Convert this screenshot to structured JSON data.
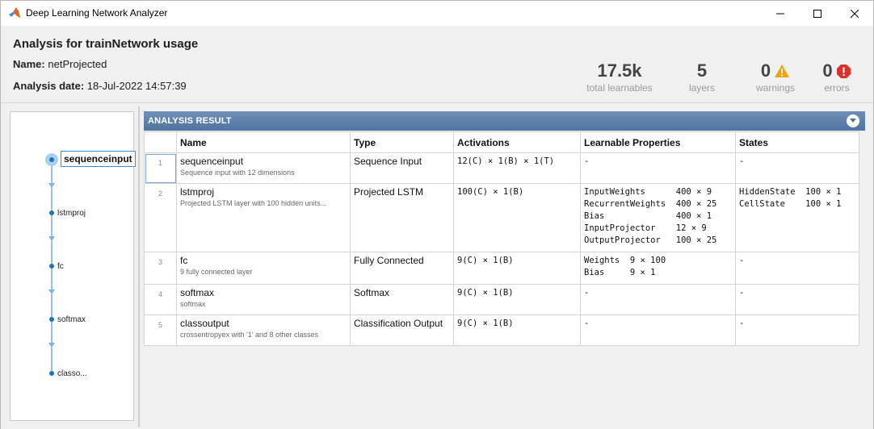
{
  "window": {
    "title": "Deep Learning Network Analyzer",
    "controls": {
      "minimize": "—",
      "maximize": "☐",
      "close": "✕"
    }
  },
  "header": {
    "title": "Analysis for trainNetwork usage",
    "name_label": "Name:",
    "name_value": "netProjected",
    "date_label": "Analysis date:",
    "date_value": "18-Jul-2022 14:57:39",
    "stats": {
      "learnables": {
        "value": "17.5k",
        "caption": "total learnables"
      },
      "layers": {
        "value": "5",
        "caption": "layers"
      },
      "warnings": {
        "value": "0",
        "caption": "warnings",
        "icon": "warning-icon",
        "color": "#f0a30a"
      },
      "errors": {
        "value": "0",
        "caption": "errors",
        "icon": "error-icon",
        "color": "#d9322b"
      }
    }
  },
  "graph": {
    "nodes": [
      {
        "label": "sequenceinput",
        "selected": true
      },
      {
        "label": "lstmproj"
      },
      {
        "label": "fc"
      },
      {
        "label": "softmax"
      },
      {
        "label": "classo..."
      }
    ],
    "accent": "#2f86c8"
  },
  "result": {
    "title": "ANALYSIS RESULT",
    "columns": [
      "",
      "Name",
      "Type",
      "Activations",
      "Learnable Properties",
      "States"
    ],
    "rows": [
      {
        "index": "1",
        "name": "sequenceinput",
        "desc": "Sequence input with 12 dimensions",
        "type": "Sequence Input",
        "activations": "12(C) × 1(B) × 1(T)",
        "learnables": "-",
        "states": "-"
      },
      {
        "index": "2",
        "name": "lstmproj",
        "desc": "Projected LSTM layer with 100 hidden units...",
        "type": "Projected LSTM",
        "activations": "100(C) × 1(B)",
        "learnables": "InputWeights      400 × 9\nRecurrentWeights  400 × 25\nBias              400 × 1\nInputProjector    12 × 9\nOutputProjector   100 × 25",
        "states": "HiddenState  100 × 1\nCellState    100 × 1"
      },
      {
        "index": "3",
        "name": "fc",
        "desc": "9 fully connected layer",
        "type": "Fully Connected",
        "activations": "9(C) × 1(B)",
        "learnables": "Weights  9 × 100\nBias     9 × 1",
        "states": "-"
      },
      {
        "index": "4",
        "name": "softmax",
        "desc": "softmax",
        "type": "Softmax",
        "activations": "9(C) × 1(B)",
        "learnables": "-",
        "states": "-"
      },
      {
        "index": "5",
        "name": "classoutput",
        "desc": "crossentropyex with '1' and 8 other classes",
        "type": "Classification Output",
        "activations": "9(C) × 1(B)",
        "learnables": "-",
        "states": "-"
      }
    ]
  }
}
